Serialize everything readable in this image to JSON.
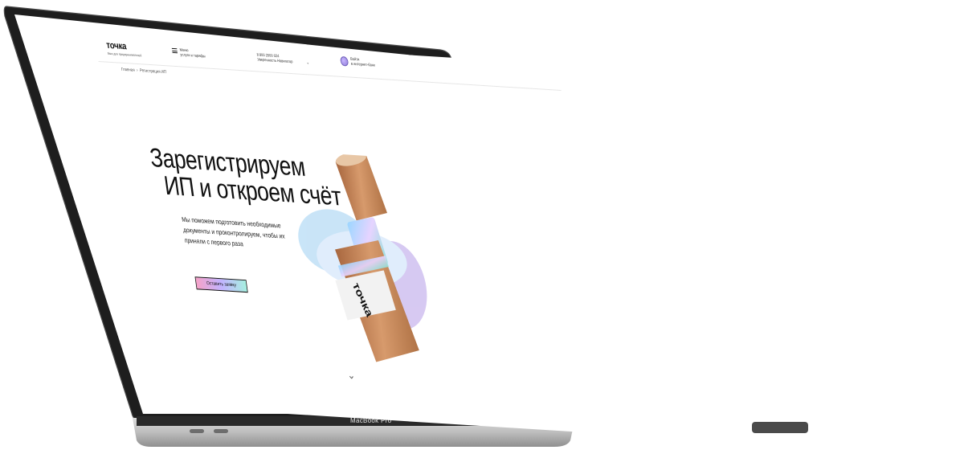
{
  "device": {
    "model_label": "MacBook Pro"
  },
  "site": {
    "logo": "точка",
    "logo_sub": "банк для предпринимателей",
    "menu": {
      "line1": "Меню",
      "line2": "услуги и тарифы"
    },
    "phone": {
      "number": "8 800 2000 024",
      "note": "Уверенность Навигатор"
    },
    "login": {
      "line1": "Войти",
      "line2": "в интернет-банк"
    },
    "breadcrumbs": [
      "Главная",
      "Регистрация ИП"
    ],
    "breadcrumb_separator": "›"
  },
  "hero": {
    "title_line1": "Зарегистрируем",
    "title_line2": "ИП и откроем счёт",
    "text": "Мы поможем подготовить необходимые документы и проконтролируем, чтобы их приняли с первого раза",
    "cta": "Оставить заявку",
    "tube_label": "точка"
  },
  "icons": {
    "menu": "hamburger-icon",
    "login": "avatar-icon",
    "scroll": "chevron-down-icon",
    "phone_dropdown": "chevron-down-icon"
  },
  "colors": {
    "cta_gradient": [
      "#f6a2c8",
      "#c2b3ff",
      "#a6f0e0"
    ],
    "tube": "#c98a5e"
  }
}
